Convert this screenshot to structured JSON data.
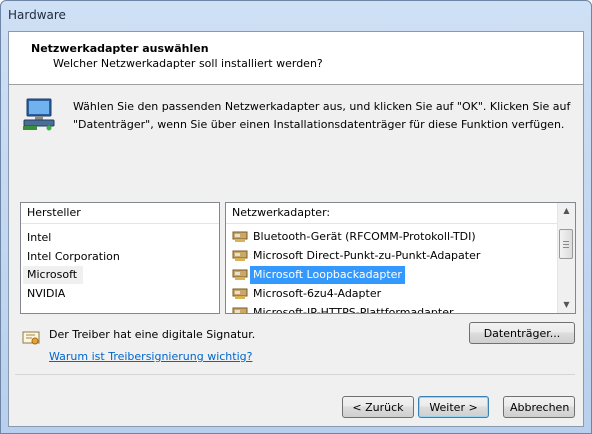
{
  "window": {
    "title": "Hardware"
  },
  "header": {
    "title": "Netzwerkadapter auswählen",
    "subtitle": "Welcher Netzwerkadapter soll installiert werden?"
  },
  "instruction": {
    "line1": "Wählen Sie den passenden Netzwerkadapter aus, und klicken Sie auf \"OK\". Klicken Sie auf",
    "line2": "\"Datenträger\", wenn Sie über einen Installationsdatenträger für diese Funktion verfügen."
  },
  "manufacturers": {
    "header": "Hersteller",
    "items": [
      "Intel",
      "Intel Corporation",
      "Microsoft",
      "NVIDIA"
    ],
    "selected": "Microsoft"
  },
  "adapters": {
    "header": "Netzwerkadapter:",
    "items": [
      "Bluetooth-Gerät (RFCOMM-Protokoll-TDI)",
      "Microsoft Direct-Punkt-zu-Punkt-Adapater",
      "Microsoft Loopbackadapter",
      "Microsoft-6zu4-Adapter",
      "Microsoft-IP-HTTPS-Plattformadapter"
    ],
    "selected": "Microsoft Loopbackadapter"
  },
  "signature": {
    "text": "Der Treiber hat eine digitale Signatur.",
    "link": "Warum ist Treibersignierung wichtig?"
  },
  "buttons": {
    "disk": "Datenträger...",
    "back": "< Zurück",
    "next": "Weiter >",
    "cancel": "Abbrechen"
  },
  "colors": {
    "selection": "#3399ff",
    "link": "#0066cc",
    "frame": "#b8d0ee"
  },
  "icons": {
    "hardware": "network-hardware-icon",
    "adapter": "network-adapter-icon",
    "signature": "certificate-icon"
  }
}
